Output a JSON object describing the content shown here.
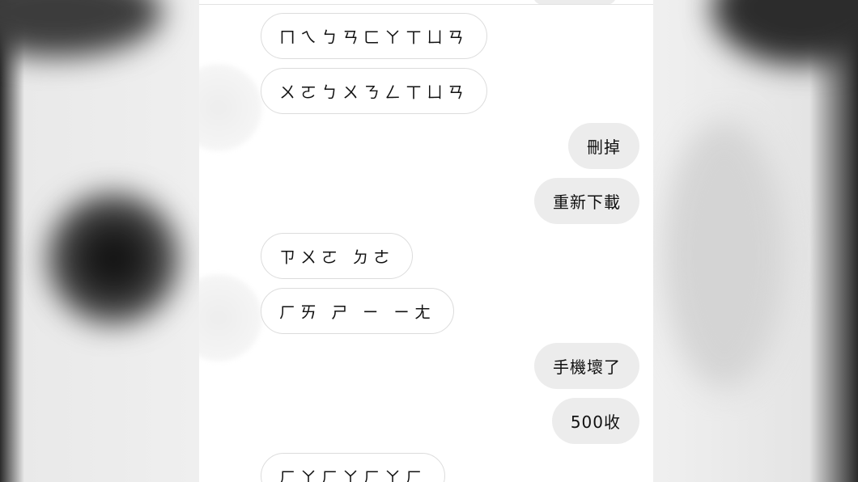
{
  "messages": [
    {
      "side": "received",
      "text": "ㄇㄟㄅㄢㄈㄚㄒㄩㄢ"
    },
    {
      "side": "received",
      "text": "ㄨㄛㄅㄨㄋㄥㄒㄩㄢ"
    },
    {
      "side": "sent",
      "text": "刪掉"
    },
    {
      "side": "sent",
      "text": "重新下載"
    },
    {
      "side": "received",
      "text": "ㄗㄨㄛ ㄉㄜ"
    },
    {
      "side": "received",
      "text": "ㄏㄞ ㄕ ㄧ ㄧㄤ"
    },
    {
      "side": "sent",
      "text": "手機壞了"
    },
    {
      "side": "sent",
      "text": "500收"
    },
    {
      "side": "received",
      "text": "ㄏㄚㄏㄚㄏㄚㄏ"
    }
  ]
}
